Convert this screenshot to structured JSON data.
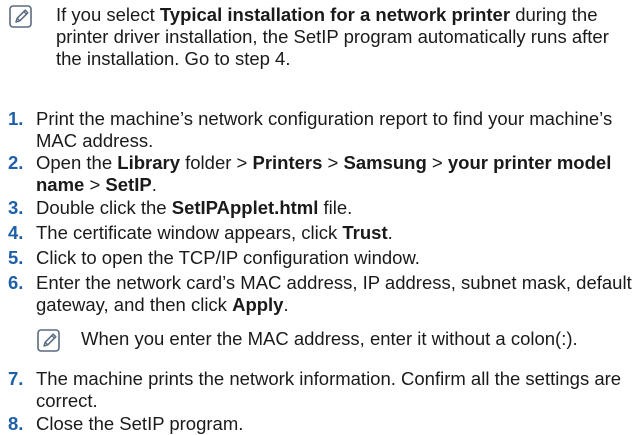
{
  "top_note": {
    "icon": "note-pencil-icon",
    "parts": [
      {
        "text": "If you select ",
        "bold": false
      },
      {
        "text": "Typical installation for a network printer",
        "bold": true
      },
      {
        "text": " during the printer driver installation, the SetIP program automatically runs after the installation. Go to step 4.",
        "bold": false
      }
    ]
  },
  "steps": [
    {
      "number": "1.",
      "parts": [
        {
          "text": "Print the machine’s network configuration report to find your machine’s MAC address.",
          "bold": false
        }
      ]
    },
    {
      "number": "2.",
      "parts": [
        {
          "text": "Open the ",
          "bold": false
        },
        {
          "text": "Library",
          "bold": true
        },
        {
          "text": " folder > ",
          "bold": false
        },
        {
          "text": "Printers",
          "bold": true
        },
        {
          "text": " > ",
          "bold": false
        },
        {
          "text": "Samsung",
          "bold": true
        },
        {
          "text": " > ",
          "bold": false
        },
        {
          "text": "your printer model name",
          "bold": true
        },
        {
          "text": " > ",
          "bold": false
        },
        {
          "text": "SetIP",
          "bold": true
        },
        {
          "text": ".",
          "bold": false
        }
      ]
    },
    {
      "number": "3.",
      "parts": [
        {
          "text": "Double click the ",
          "bold": false
        },
        {
          "text": "SetIPApplet.html",
          "bold": true
        },
        {
          "text": " file.",
          "bold": false
        }
      ]
    },
    {
      "number": "4.",
      "parts": [
        {
          "text": "The certificate window appears, click ",
          "bold": false
        },
        {
          "text": "Trust",
          "bold": true
        },
        {
          "text": ".",
          "bold": false
        }
      ]
    },
    {
      "number": "5.",
      "parts": [
        {
          "text": "Click to open the TCP/IP configuration window.",
          "bold": false
        }
      ]
    },
    {
      "number": "6.",
      "parts": [
        {
          "text": "Enter the network card’s MAC address, IP address, subnet mask, default gateway, and then click ",
          "bold": false
        },
        {
          "text": "Apply",
          "bold": true
        },
        {
          "text": ".",
          "bold": false
        }
      ]
    },
    {
      "number": "7.",
      "parts": [
        {
          "text": "The machine prints the network information. Confirm all the settings are correct.",
          "bold": false
        }
      ]
    },
    {
      "number": "8.",
      "parts": [
        {
          "text": "Close the SetIP program.",
          "bold": false
        }
      ]
    }
  ],
  "inner_note": {
    "icon": "note-pencil-icon",
    "parts": [
      {
        "text": "When you enter the MAC address, enter it without a colon(:).",
        "bold": false
      }
    ]
  },
  "colors": {
    "step_number": "#1f5fa8",
    "text": "#1a1a1a",
    "icon_stroke": "#5a6a80"
  }
}
